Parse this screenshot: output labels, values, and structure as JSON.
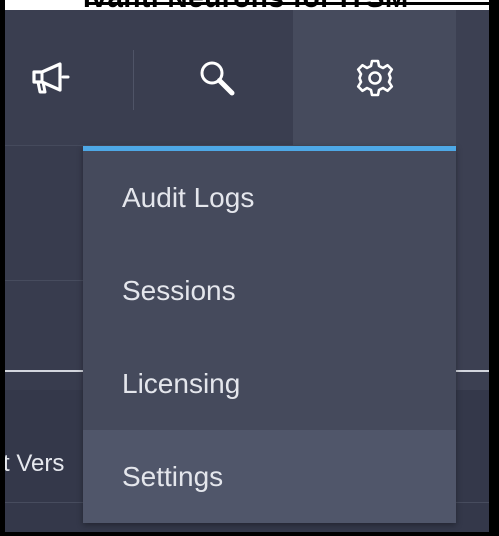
{
  "page_heading": "Ivanti Neurons for ITSM",
  "toolbar": {
    "buttons": [
      {
        "name": "announcements",
        "icon": "megaphone-icon"
      },
      {
        "name": "search",
        "icon": "search-icon"
      },
      {
        "name": "settings",
        "icon": "gear-icon",
        "active": true
      }
    ]
  },
  "settings_menu": {
    "items": [
      {
        "label": "Audit Logs"
      },
      {
        "label": "Sessions"
      },
      {
        "label": "Licensing"
      },
      {
        "label": "Settings",
        "highlighted": true
      }
    ]
  },
  "background": {
    "column_header": "t Vers"
  },
  "colors": {
    "toolbar_bg": "#3a3e50",
    "menu_bg": "#454a5c",
    "menu_accent": "#4ea8e6",
    "menu_item_hover": "#50566a",
    "menu_text": "#e4e6ec"
  }
}
